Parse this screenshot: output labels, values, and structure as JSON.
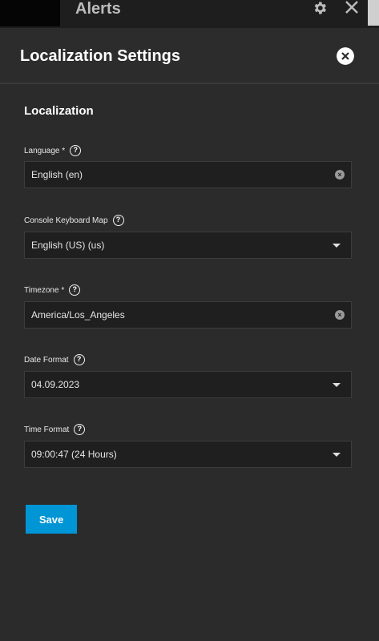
{
  "topbar": {
    "title": "Alerts",
    "settings_icon": "gear-icon",
    "close_icon": "close-icon"
  },
  "panel": {
    "title": "Localization Settings",
    "close_icon": "close-circle-icon",
    "section_title": "Localization",
    "fields": [
      {
        "label": "Language",
        "required": true,
        "value": "English (en)",
        "control": "clearable-autocomplete"
      },
      {
        "label": "Console Keyboard Map",
        "required": false,
        "value": "English (US) (us)",
        "control": "select"
      },
      {
        "label": "Timezone",
        "required": true,
        "value": "America/Los_Angeles",
        "control": "clearable-autocomplete"
      },
      {
        "label": "Date Format",
        "required": false,
        "value": "04.09.2023",
        "control": "select"
      },
      {
        "label": "Time Format",
        "required": false,
        "value": "09:00:47 (24 Hours)",
        "control": "select"
      }
    ],
    "required_marker": "*",
    "help_glyph": "?",
    "save_label": "Save"
  },
  "colors": {
    "background": "#2b2b2b",
    "field_bg": "#1f1f1f",
    "accent": "#0095d5"
  }
}
